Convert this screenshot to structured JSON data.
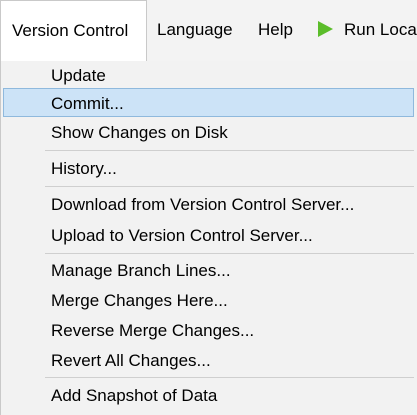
{
  "menubar": {
    "items": [
      {
        "label": "Version Control"
      },
      {
        "label": "Language"
      },
      {
        "label": "Help"
      },
      {
        "label": "Run Loca"
      }
    ],
    "run_icon": "play-icon",
    "run_icon_color": "#5bbd2a"
  },
  "dropdown": {
    "items": [
      {
        "label": "Update"
      },
      {
        "label": "Commit..."
      },
      {
        "label": "Show Changes on Disk"
      },
      {
        "label": "History..."
      },
      {
        "label": "Download from Version Control Server..."
      },
      {
        "label": "Upload to Version Control Server..."
      },
      {
        "label": "Manage Branch Lines..."
      },
      {
        "label": "Merge Changes Here..."
      },
      {
        "label": "Reverse Merge Changes..."
      },
      {
        "label": "Revert All Changes..."
      },
      {
        "label": "Add Snapshot of Data"
      }
    ],
    "highlight_color": "#cce3f7"
  }
}
